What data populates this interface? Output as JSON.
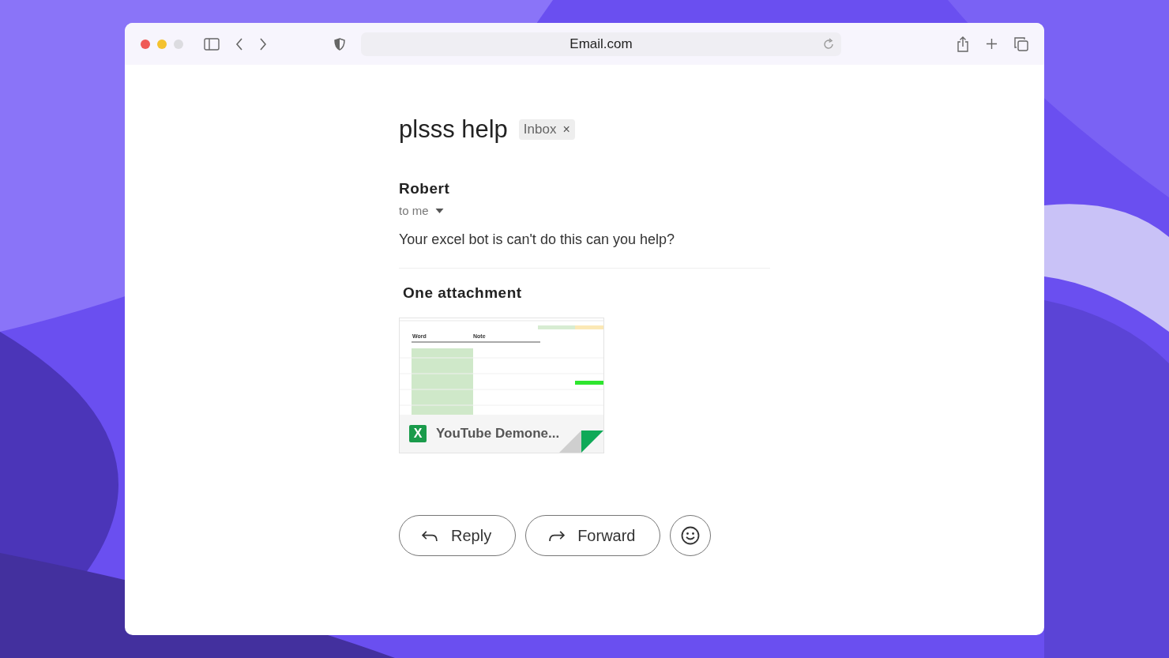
{
  "browser": {
    "address": "Email.com"
  },
  "email": {
    "subject": "plsss help",
    "label": {
      "text": "Inbox",
      "close": "×"
    },
    "sender": "Robert",
    "recipient": "to me",
    "body": "Your excel bot is can't do this can you help?"
  },
  "attachments": {
    "heading": "One attachment",
    "items": [
      {
        "name": "YouTube Demone...",
        "badge": "X",
        "preview_headers": [
          "Word",
          "Note"
        ]
      }
    ]
  },
  "actions": [
    {
      "kind": "reply",
      "label": "Reply"
    },
    {
      "kind": "forward",
      "label": "Forward"
    },
    {
      "kind": "emoji"
    }
  ]
}
